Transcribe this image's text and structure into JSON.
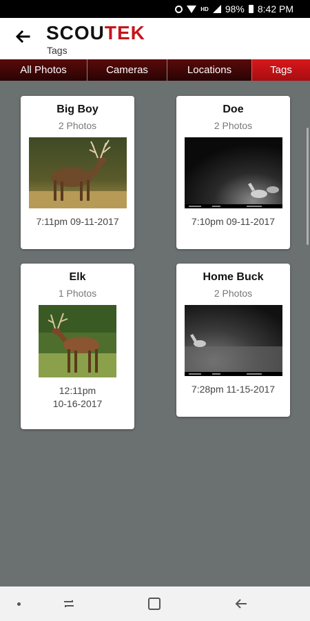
{
  "status_bar": {
    "battery": "98%",
    "time": "8:42 PM",
    "network": "HD"
  },
  "header": {
    "logo_main": "SCOU",
    "logo_accent": "TEK",
    "subtitle": "Tags"
  },
  "tabs": [
    {
      "label": "All Photos",
      "active": false
    },
    {
      "label": "Cameras",
      "active": false
    },
    {
      "label": "Locations",
      "active": false
    },
    {
      "label": "Tags",
      "active": true
    }
  ],
  "tags": [
    {
      "name": "Big Boy",
      "count": "2 Photos",
      "date": "7:11pm 09-11-2017",
      "image": "deer-buck-photo"
    },
    {
      "name": "Doe",
      "count": "2 Photos",
      "date": "7:10pm 09-11-2017",
      "image": "night-trail-camera-photo"
    },
    {
      "name": "Elk",
      "count": "1 Photos",
      "date_line1": "12:11pm",
      "date_line2": "10-16-2017",
      "image": "elk-photo"
    },
    {
      "name": "Home Buck",
      "count": "2 Photos",
      "date": "7:28pm 11-15-2017",
      "image": "night-trail-camera-photo"
    }
  ],
  "colors": {
    "accent": "#c4161c",
    "background": "#6b7070",
    "tab_inactive": "#3a0505"
  }
}
